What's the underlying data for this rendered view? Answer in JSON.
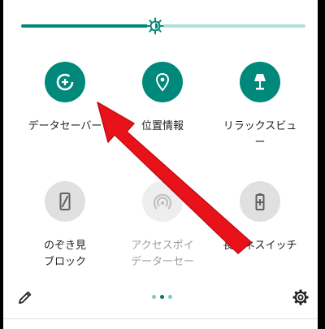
{
  "brightness": {
    "level": 0.47
  },
  "tiles": [
    {
      "label": "データセーバー",
      "icon": "data-saver-icon",
      "state": "on"
    },
    {
      "label": "位置情報",
      "icon": "location-pin-icon",
      "state": "on"
    },
    {
      "label": "リラックスビュ\nー",
      "icon": "lamp-icon",
      "state": "on"
    },
    {
      "label": "のぞき見\nブロック",
      "icon": "phone-privacy-icon",
      "state": "off"
    },
    {
      "label": "アクセスポイ\nデーターセー",
      "icon": "hotspot-icon",
      "state": "unavailable"
    },
    {
      "label": "長エネスイッチ",
      "icon": "battery-saver-icon",
      "state": "off"
    }
  ],
  "pager": {
    "pages": 3,
    "current": 2
  },
  "colors": {
    "accent": "#00897b",
    "annotation_arrow": "#e8121b"
  }
}
